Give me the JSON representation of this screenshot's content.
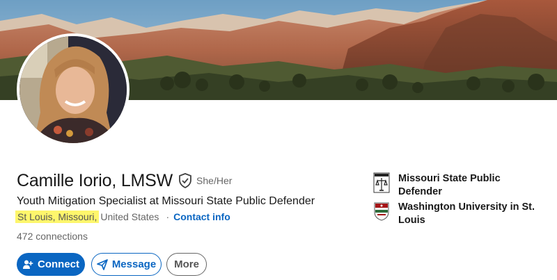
{
  "profile": {
    "name": "Camille Iorio, LMSW",
    "pronouns": "She/Her",
    "headline": "Youth Mitigation Specialist at Missouri State Public Defender",
    "location_highlighted": "St Louis, Missouri,",
    "location_rest": "United States",
    "separator": "·",
    "contact_info": "Contact info",
    "connections": "472 connections"
  },
  "actions": {
    "connect": "Connect",
    "message": "Message",
    "more": "More"
  },
  "organizations": [
    {
      "name": "Missouri State Public Defender",
      "logo": "public-defender-seal-icon"
    },
    {
      "name": "Washington University in St. Louis",
      "logo": "washu-shield-icon"
    }
  ],
  "colors": {
    "accent": "#0a66c2",
    "location_highlight": "#fef66c",
    "text_secondary": "#666666"
  }
}
